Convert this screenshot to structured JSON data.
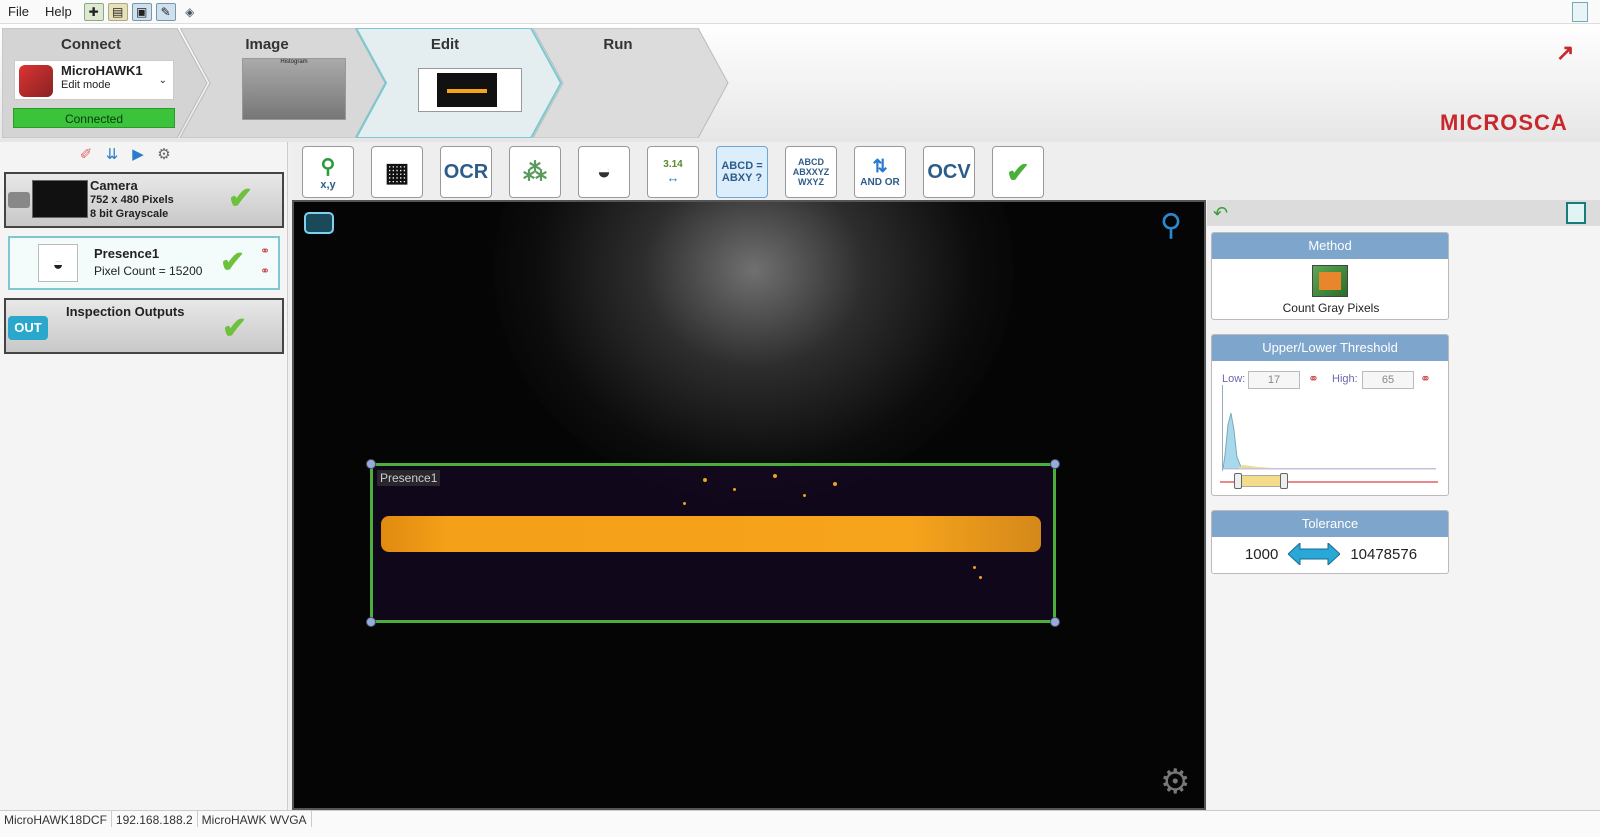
{
  "menu": {
    "items": [
      "File",
      "Help"
    ]
  },
  "toolbar_icons": [
    "new-job-icon",
    "open-job-icon",
    "save-icon",
    "save-as-icon",
    "device-icon"
  ],
  "steps": {
    "connect": "Connect",
    "image": "Image",
    "edit": "Edit",
    "run": "Run"
  },
  "device": {
    "name": "MicroHAWK1",
    "mode": "Edit mode",
    "status": "Connected"
  },
  "image_thumb_label": "Histogram",
  "brand": "MICROSCA",
  "left_tools": [
    "eraser-icon",
    "chevron-down-double-icon",
    "play-icon",
    "settings-icon"
  ],
  "tools": [
    {
      "name": "locate-tool",
      "label": "x,y"
    },
    {
      "name": "datamatrix-tool",
      "label": ""
    },
    {
      "name": "ocr-tool",
      "label": "OCR"
    },
    {
      "name": "count-tool",
      "label": ""
    },
    {
      "name": "presence-tool",
      "label": ""
    },
    {
      "name": "measure-tool",
      "label": "3.14"
    },
    {
      "name": "match-string-tool",
      "label": "ABCD = ABXY ?"
    },
    {
      "name": "compare-string-tool",
      "label": "ABCD ABXXYZ WXYZ"
    },
    {
      "name": "logic-tool",
      "label": "AND OR"
    },
    {
      "name": "ocv-tool",
      "label": "OCV"
    },
    {
      "name": "verify-tool",
      "label": ""
    }
  ],
  "camera_item": {
    "title": "Camera",
    "line1": "752 x 480 Pixels",
    "line2": "8 bit Grayscale"
  },
  "presence_item": {
    "title": "Presence1",
    "sub": "Pixel Count = 15200"
  },
  "outputs_item": {
    "title": "Inspection Outputs",
    "badge": "OUT"
  },
  "roi": {
    "label": "Presence1"
  },
  "method": {
    "header": "Method",
    "label": "Count Gray Pixels"
  },
  "threshold": {
    "header": "Upper/Lower Threshold",
    "low_label": "Low:",
    "low_value": "17",
    "high_label": "High:",
    "high_value": "65",
    "low_fraction": 0.067,
    "high_fraction": 0.255
  },
  "tolerance": {
    "header": "Tolerance",
    "min": "1000",
    "max": "10478576"
  },
  "status": {
    "device": "MicroHAWK18DCF",
    "ip": "192.168.188.2",
    "model": "MicroHAWK WVGA"
  },
  "colors": {
    "accent": "#7ea6cc",
    "roi": "#4caf3a",
    "band": "#f6a41c",
    "brand": "#c8282c",
    "connected": "#3cc33c"
  }
}
